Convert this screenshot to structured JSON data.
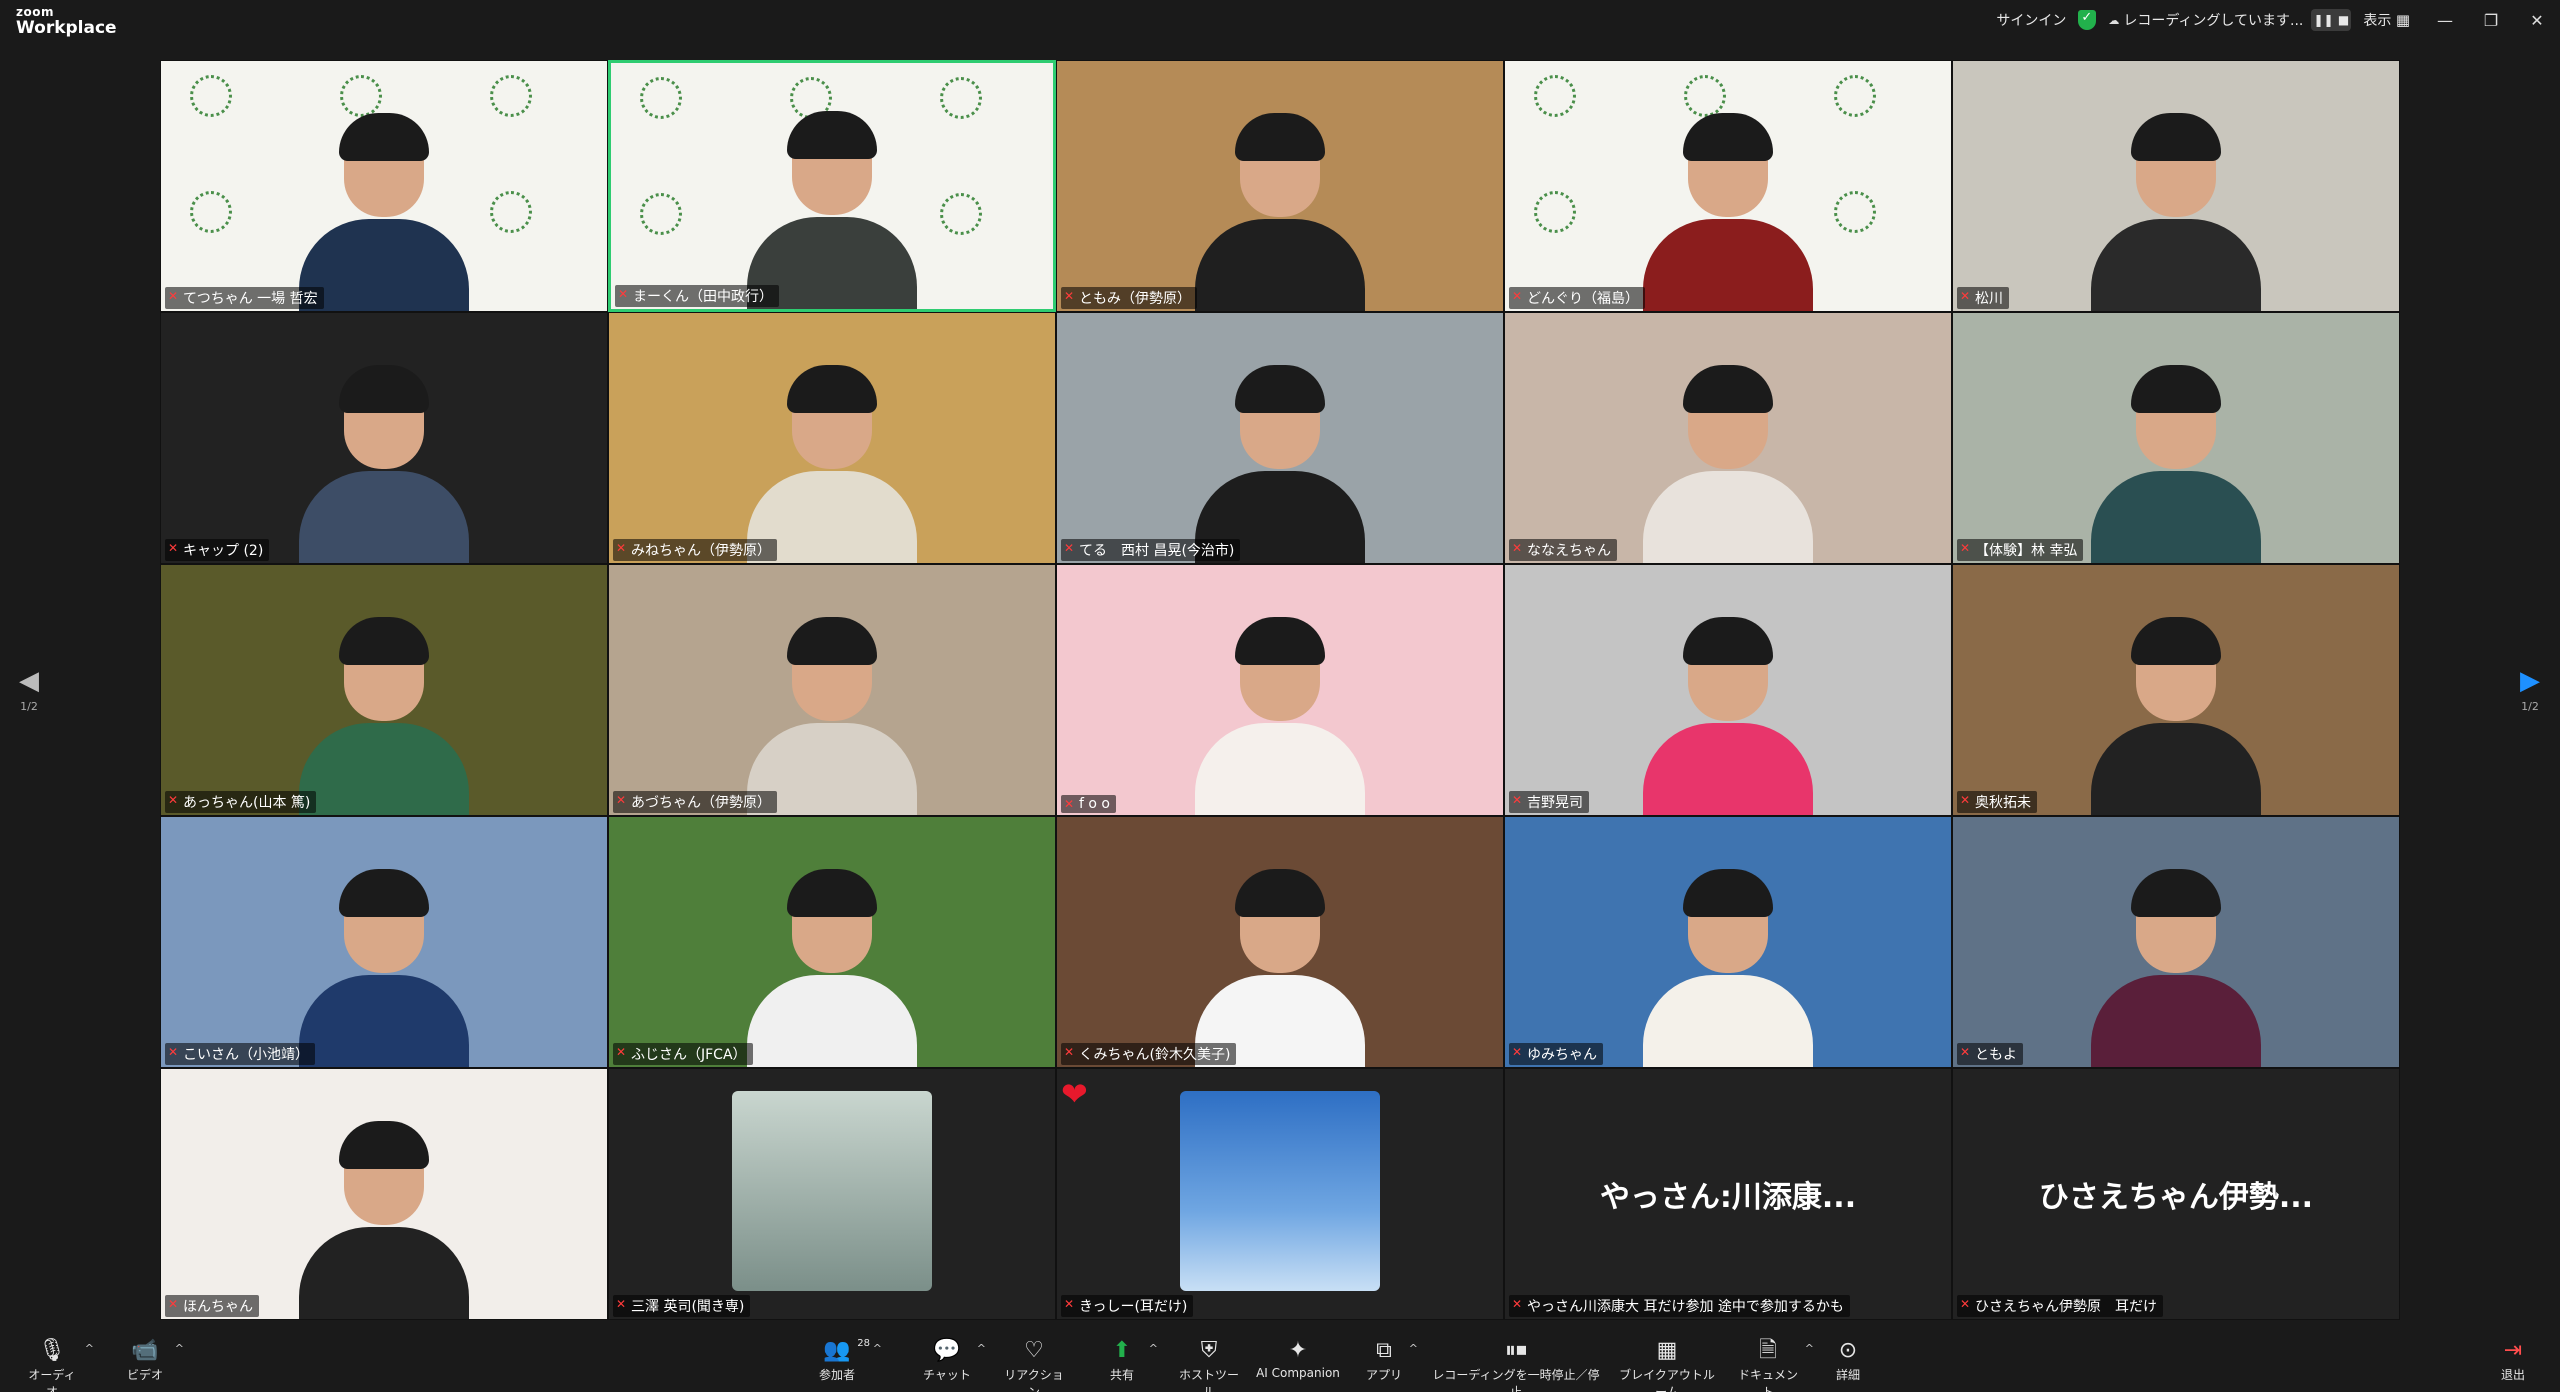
{
  "app": {
    "brand_small": "zoom",
    "brand_large": "Workplace"
  },
  "topbar": {
    "signin": "サインイン",
    "recording_text": "レコーディングしています...",
    "view_label": "表示"
  },
  "pagination": {
    "left": "1/2",
    "right": "1/2"
  },
  "participants": [
    {
      "name": "てつちゃん 一場 哲宏",
      "bg": "logo",
      "shirt": "#1f3350"
    },
    {
      "name": "まーくん（田中政行）",
      "bg": "logo",
      "shirt": "#3a3f3c",
      "active": true
    },
    {
      "name": "ともみ（伊勢原）",
      "bg": "#b58b57",
      "shirt": "#1f1f1f"
    },
    {
      "name": "どんぐり（福島）",
      "bg": "logo",
      "shirt": "#8b1d1d"
    },
    {
      "name": "松川",
      "bg": "#c9c6bd",
      "shirt": "#2a2a2a"
    },
    {
      "name": "キャップ (2)",
      "bg": "#222222",
      "shirt": "#3d4d66"
    },
    {
      "name": "みねちゃん（伊勢原）",
      "bg": "#c9a15a",
      "shirt": "#e2dccd"
    },
    {
      "name": "てる　西村 昌晃(今治市)",
      "bg": "#9aa3a8",
      "shirt": "#1d1d1d"
    },
    {
      "name": "ななえちゃん",
      "bg": "#c8b6a8",
      "shirt": "#e8e2dc"
    },
    {
      "name": "【体験】林 幸弘",
      "bg": "#aab3a7",
      "shirt": "#2a4f52"
    },
    {
      "name": "あっちゃん(山本 篤)",
      "bg": "#5a5a2a",
      "shirt": "#2f6b4a"
    },
    {
      "name": "あづちゃん（伊勢原）",
      "bg": "#b5a48f",
      "shirt": "#d7d0c6"
    },
    {
      "name": "f o o",
      "bg": "#f3c8cf",
      "shirt": "#f5f0ec"
    },
    {
      "name": "吉野晃司",
      "bg": "#c4c4c4",
      "shirt": "#e8356b"
    },
    {
      "name": "奥秋拓未",
      "bg": "#8a6a48",
      "shirt": "#222222"
    },
    {
      "name": "こいさん（小池靖）",
      "bg": "#7b98bd",
      "shirt": "#1f3a6b"
    },
    {
      "name": "ふじさん（JFCA）",
      "bg": "#4f7f3a",
      "shirt": "#f0f0f0"
    },
    {
      "name": "くみちゃん(鈴木久美子)",
      "bg": "#6b4a35",
      "shirt": "#f5f5f5"
    },
    {
      "name": "ゆみちゃん",
      "bg": "#3f74b0",
      "shirt": "#f4f1ea"
    },
    {
      "name": "ともよ",
      "bg": "#5f7287",
      "shirt": "#5a1f3a"
    },
    {
      "name": "ほんちゃん",
      "bg": "#f2eeea",
      "shirt": "#222222"
    },
    {
      "name": "三澤 英司(聞き専)",
      "bg": "#222222",
      "avatar": "photo-soccer"
    },
    {
      "name": "きっしー(耳だけ)",
      "bg": "#222222",
      "avatar": "photo-sky",
      "heart": true
    },
    {
      "name": "やっさん川添康大 耳だけ参加  途中で参加するかも",
      "bg": "#222222",
      "display": "やっさん:川添康..."
    },
    {
      "name": "ひさえちゃん伊勢原　耳だけ",
      "bg": "#222222",
      "display": "ひさえちゃん伊勢..."
    }
  ],
  "toolbar": {
    "audio": "オーディオ",
    "video": "ビデオ",
    "participants": "参加者",
    "participants_count": "28",
    "chat": "チャット",
    "reactions": "リアクション",
    "share": "共有",
    "host_tools": "ホストツール",
    "ai_companion": "AI Companion",
    "apps": "アプリ",
    "recording": "レコーディングを一時停止／停止",
    "breakout": "ブレイクアウトルーム",
    "docs": "ドキュメント",
    "more": "詳細",
    "leave": "退出"
  },
  "icons": {
    "mic": "microphone-icon",
    "video": "video-camera-icon",
    "participants": "people-icon",
    "chat": "chat-bubble-icon",
    "reactions": "heart-icon",
    "share": "share-arrow-icon",
    "host": "shield-icon",
    "ai": "sparkle-icon",
    "apps": "apps-icon",
    "record": "pause-stop-icon",
    "breakout": "grid-icon",
    "docs": "document-icon",
    "more": "ellipsis-icon",
    "leave": "door-exit-icon"
  },
  "colors": {
    "active_border": "#2ecc71",
    "share_green": "#22b14c",
    "muted_red": "#ff3b3b",
    "nav_blue": "#1e90ff"
  }
}
